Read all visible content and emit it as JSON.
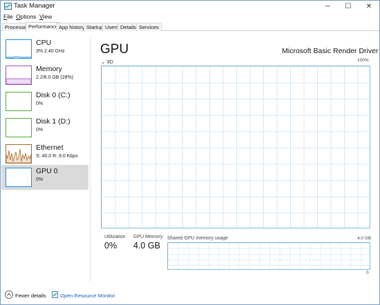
{
  "window": {
    "title": "Task Manager",
    "controls": {
      "minimize": "─",
      "maximize": "☐",
      "close": "✕"
    },
    "app_icon": "task-manager-icon"
  },
  "menu": [
    {
      "label": "File",
      "mnemonic": "F",
      "rest": "ile"
    },
    {
      "label": "Options",
      "mnemonic": "O",
      "rest": "ptions"
    },
    {
      "label": "View",
      "mnemonic": "V",
      "rest": "iew"
    }
  ],
  "tabs": [
    "Processes",
    "Performance",
    "App history",
    "Startup",
    "Users",
    "Details",
    "Services"
  ],
  "active_tab": "Performance",
  "sidebar": {
    "items": [
      {
        "title": "CPU",
        "subtitle": "3%  2.40 GHz",
        "color": "#1e88e5"
      },
      {
        "title": "Memory",
        "subtitle": "2.2/8.0 GB (28%)",
        "color": "#a24cc2"
      },
      {
        "title": "Disk 0 (C:)",
        "subtitle": "0%",
        "color": "#4cae2c"
      },
      {
        "title": "Disk 1 (D:)",
        "subtitle": "0%",
        "color": "#4cae2c"
      },
      {
        "title": "Ethernet",
        "subtitle": "S: 40.0  R: 8.0 Kbps",
        "color": "#a7672a"
      },
      {
        "title": "GPU 0",
        "subtitle": "0%",
        "color": "#1e88e5"
      }
    ],
    "selected": "GPU 0"
  },
  "main": {
    "title": "GPU",
    "model": "Microsoft Basic Render Driver",
    "graph_label": "⌄ 3D",
    "graph_max": "100%",
    "utilization_label": "Utilization",
    "utilization_value": "0%",
    "gpu_memory_label": "GPU Memory",
    "gpu_memory_value": "4.0 GB",
    "shared_label": "Shared GPU memory usage",
    "shared_max": "4.0 GB",
    "shared_min": "0"
  },
  "footer": {
    "fewer_details": "Fewer details",
    "fewer_mnemonic": "d",
    "open_resource_monitor": "Open Resource Monitor"
  },
  "colors": {
    "graph_border": "#80b9e0",
    "link": "#1a5fb4",
    "selected_bg": "#dadada"
  }
}
